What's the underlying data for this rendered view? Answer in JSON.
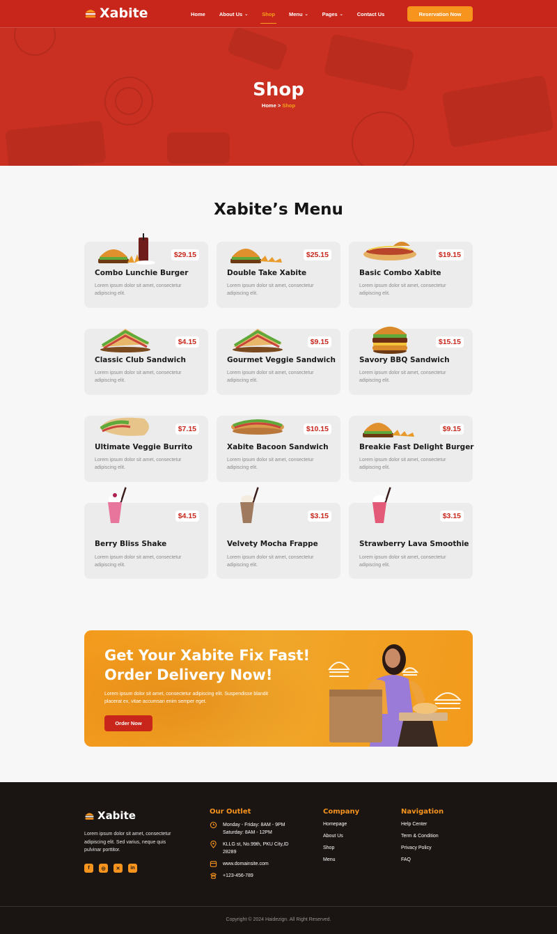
{
  "brand": "Xabite",
  "nav": {
    "items": [
      {
        "label": "Home",
        "chevron": false
      },
      {
        "label": "About Us",
        "chevron": true
      },
      {
        "label": "Shop",
        "chevron": false,
        "active": true
      },
      {
        "label": "Menu",
        "chevron": true
      },
      {
        "label": "Pages",
        "chevron": true
      },
      {
        "label": "Contact Us",
        "chevron": false
      }
    ],
    "cta": "Reservation Now"
  },
  "hero": {
    "title": "Shop",
    "breadcrumb_home": "Home",
    "breadcrumb_sep": ">",
    "breadcrumb_current": "Shop"
  },
  "menu_section": {
    "title": "Xabite’s Menu",
    "items": [
      {
        "name": "Combo Lunchie Burger",
        "price": "$29.15",
        "desc": "Lorem ipsum dolor sit amet, consectetur adipiscing elit.",
        "image": "burger-combo"
      },
      {
        "name": "Double Take Xabite",
        "price": "$25.15",
        "desc": "Lorem ipsum dolor sit amet, consectetur adipiscing elit.",
        "image": "burger-fries"
      },
      {
        "name": "Basic Combo Xabite",
        "price": "$19.15",
        "desc": "Lorem ipsum dolor sit amet, consectetur adipiscing elit.",
        "image": "hotdog"
      },
      {
        "name": "Classic Club Sandwich",
        "price": "$4.15",
        "desc": "Lorem ipsum dolor sit amet, consectetur adipiscing elit.",
        "image": "sandwich"
      },
      {
        "name": "Gourmet Veggie Sandwich",
        "price": "$9.15",
        "desc": "Lorem ipsum dolor sit amet, consectetur adipiscing elit.",
        "image": "sandwich"
      },
      {
        "name": "Savory BBQ Sandwich",
        "price": "$15.15",
        "desc": "Lorem ipsum dolor sit amet, consectetur adipiscing elit.",
        "image": "burger-tall"
      },
      {
        "name": "Ultimate Veggie Burrito",
        "price": "$7.15",
        "desc": "Lorem ipsum dolor sit amet, consectetur adipiscing elit.",
        "image": "burrito"
      },
      {
        "name": "Xabite Bacoon Sandwich",
        "price": "$10.15",
        "desc": "Lorem ipsum dolor sit amet, consectetur adipiscing elit.",
        "image": "sub"
      },
      {
        "name": "Breakie Fast Delight Burger",
        "price": "$9.15",
        "desc": "Lorem ipsum dolor sit amet, consectetur adipiscing elit.",
        "image": "burger-fries"
      },
      {
        "name": "Berry Bliss Shake",
        "price": "$4.15",
        "desc": "Lorem ipsum dolor sit amet, consectetur adipiscing elit.",
        "image": "shake-pink"
      },
      {
        "name": "Velvety Mocha Frappe",
        "price": "$3.15",
        "desc": "Lorem ipsum dolor sit amet, consectetur adipiscing elit.",
        "image": "shake-mocha"
      },
      {
        "name": "Strawberry Lava Smoothie",
        "price": "$3.15",
        "desc": "Lorem ipsum dolor sit amet, consectetur adipiscing elit.",
        "image": "shake-red"
      }
    ]
  },
  "promo": {
    "title_line1": "Get Your Xabite Fix Fast!",
    "title_line2": "Order Delivery Now!",
    "text": "Lorem ipsum dolor sit amet, consectetur adipiscing elit. Suspendisse blandit placerat ex, vitae accumsan enim semper eget.",
    "button": "Order Now"
  },
  "footer": {
    "brand": "Xabite",
    "about": "Lorem ipsum dolor sit amet, consectetur adipiscing elit. Sed varius, neque quis pulvinar porttitor.",
    "socials": [
      "facebook-icon",
      "instagram-icon",
      "x-icon",
      "linkedin-icon"
    ],
    "outlet": {
      "title": "Our Outlet",
      "hours_1": "Monday - Friday: 8AM - 9PM",
      "hours_2": "Saturday: 8AM - 12PM",
      "address_1": "KLLG st, No.99th, PKU City,ID",
      "address_2": "28289",
      "website": "www.domainsite.com",
      "phone": "+123-456-789"
    },
    "company": {
      "title": "Company",
      "links": [
        "Homepage",
        "About Us",
        "Shop",
        "Menu"
      ]
    },
    "navigation": {
      "title": "Navigation",
      "links": [
        "Help Center",
        "Term & Condition",
        "Privacy Policy",
        "FAQ"
      ]
    },
    "copyright": "Copyright © 2024 Haidezign. All Right Reserved."
  },
  "colors": {
    "primary": "#c8261a",
    "accent": "#f7941d",
    "footer_bg": "#1a1413"
  }
}
